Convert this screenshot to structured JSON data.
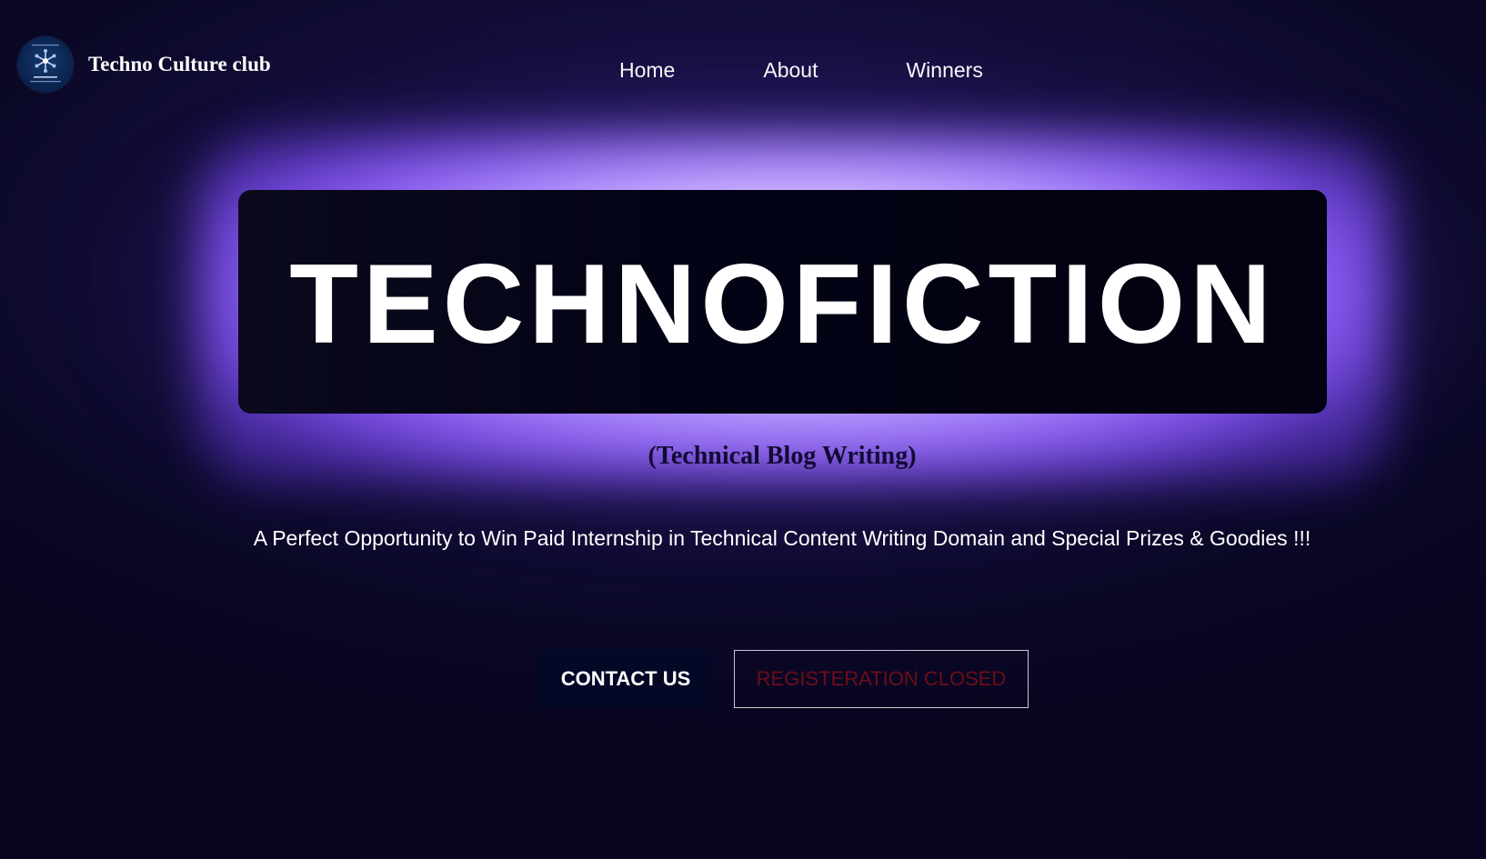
{
  "header": {
    "brand_name": "Techno Culture club",
    "logo_icon": "tcc-snowflake-logo",
    "nav": [
      {
        "label": "Home"
      },
      {
        "label": "About"
      },
      {
        "label": "Winners"
      }
    ]
  },
  "hero": {
    "title": "TECHNOFICTION",
    "subtitle": "(Technical Blog Writing)",
    "tagline": "A Perfect Opportunity to Win Paid Internship in Technical Content Writing Domain and Special Prizes & Goodies !!!"
  },
  "actions": {
    "contact_label": "CONTACT US",
    "register_label": "REGISTERATION CLOSED"
  },
  "colors": {
    "background": "#0a0826",
    "glow": "#a883ff",
    "title_box": "#020314",
    "subtitle_text": "#120a35",
    "contact_button_bg": "#050726",
    "register_text": "#6e0d18",
    "register_border": "#c9c9d2"
  }
}
